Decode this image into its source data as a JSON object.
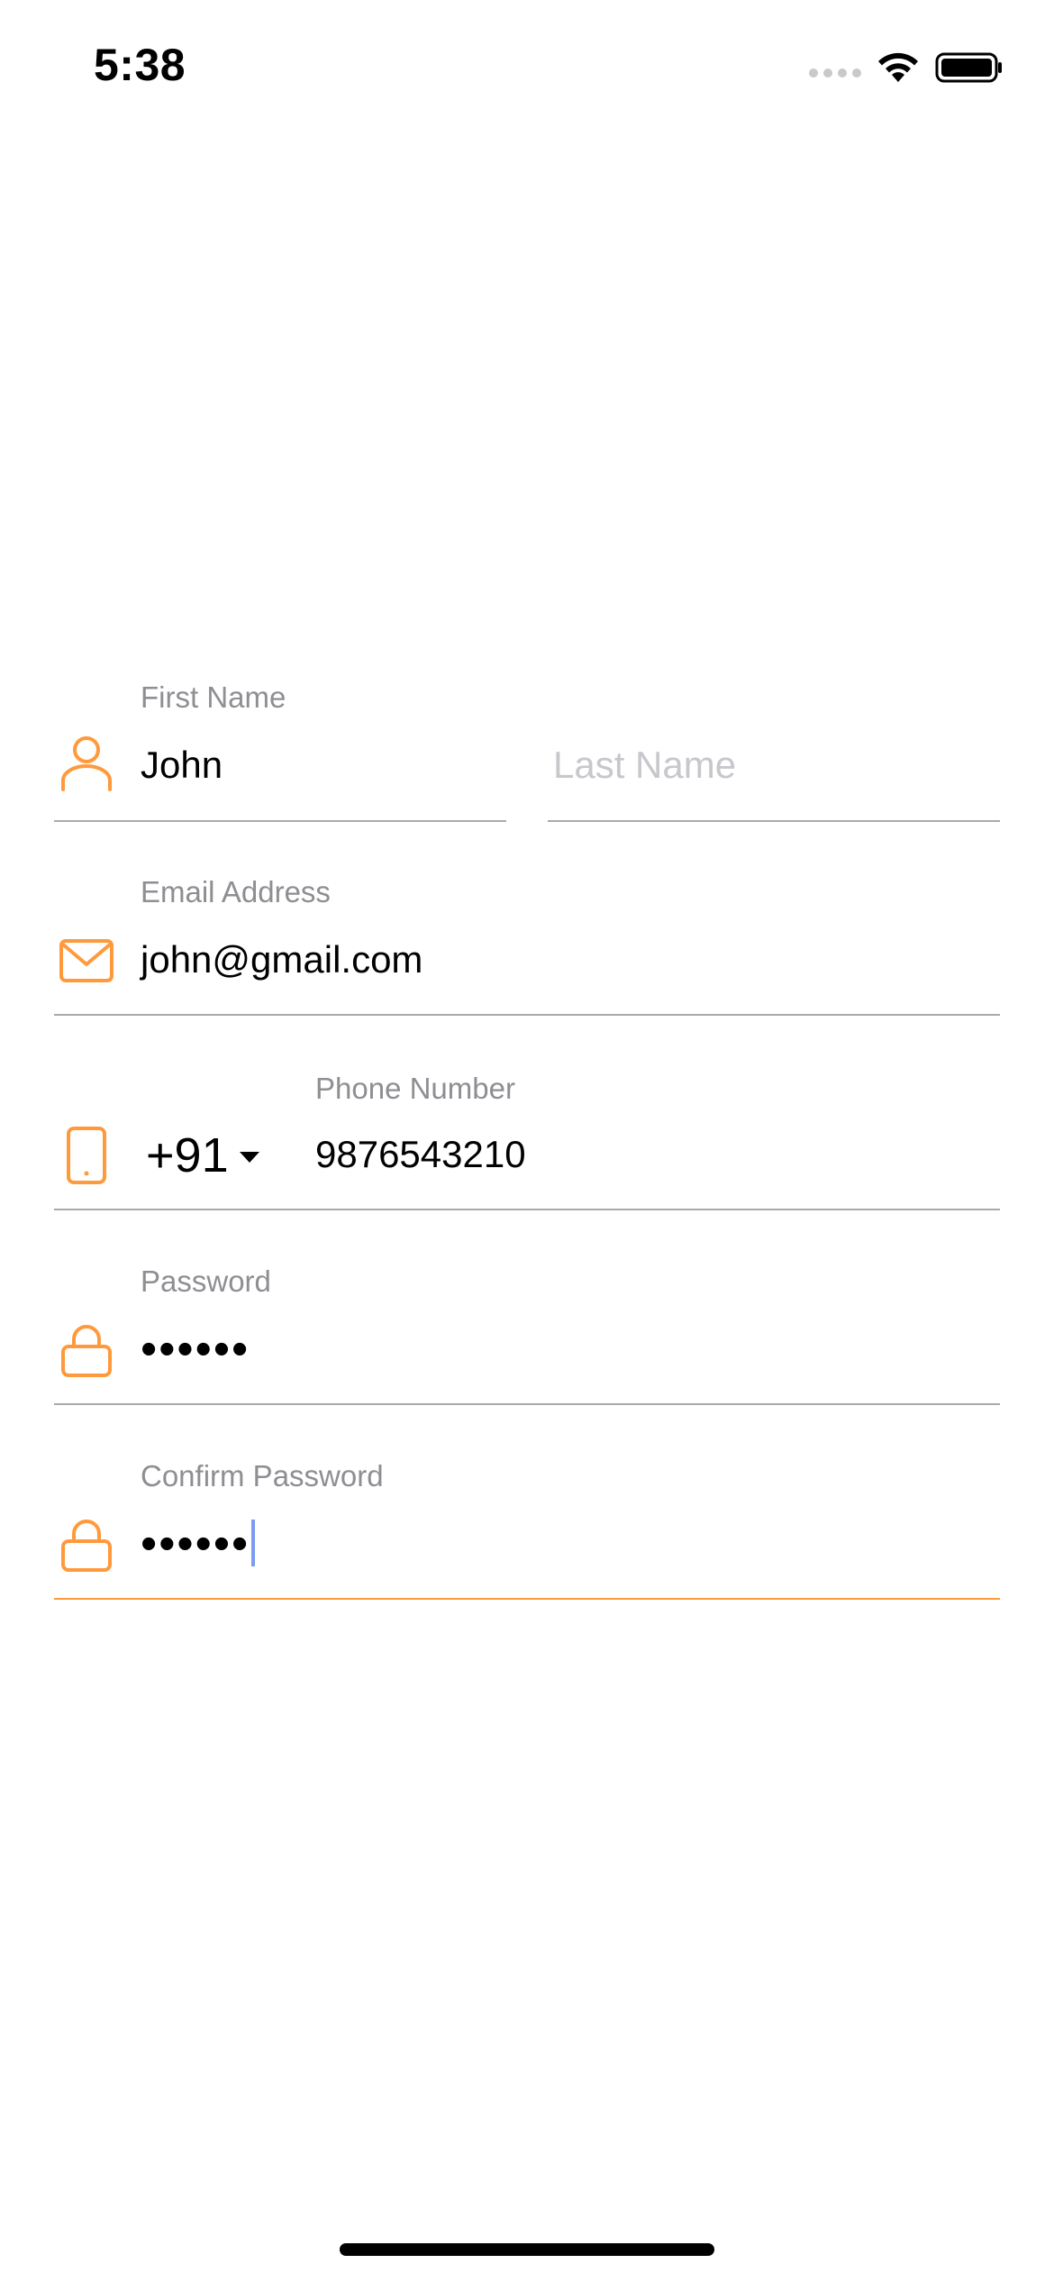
{
  "status_bar": {
    "time": "5:38"
  },
  "form": {
    "first_name": {
      "label": "First Name",
      "value": "John"
    },
    "last_name": {
      "placeholder": "Last Name"
    },
    "email": {
      "label": "Email Address",
      "value": "john@gmail.com"
    },
    "phone": {
      "country_code": "+91",
      "label": "Phone Number",
      "value": "9876543210"
    },
    "password": {
      "label": "Password",
      "value": "••••••"
    },
    "confirm_password": {
      "label": "Confirm Password",
      "value": "••••••"
    }
  },
  "colors": {
    "accent": "#ff9a3c",
    "label": "#8e8e93",
    "placeholder": "#c7c7cc",
    "underline": "#a9a9a9",
    "cursor": "#7b9cf2"
  },
  "icons": {
    "first_name": "person-icon",
    "email": "mail-icon",
    "phone": "phone-icon",
    "password": "lock-icon",
    "confirm_password": "lock-icon"
  }
}
